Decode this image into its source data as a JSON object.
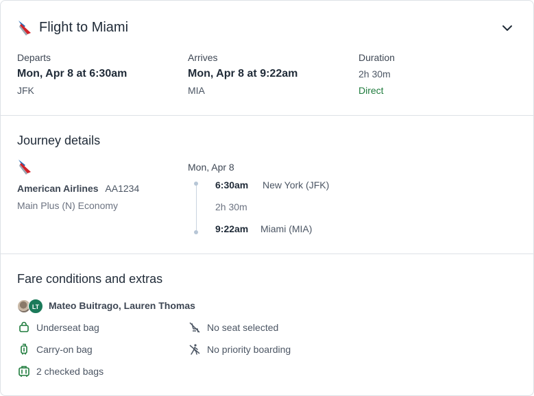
{
  "header": {
    "title": "Flight to Miami",
    "depart_label": "Departs",
    "depart_time": "Mon, Apr 8 at 6:30am",
    "depart_airport": "JFK",
    "arrive_label": "Arrives",
    "arrive_time": "Mon, Apr 8 at 9:22am",
    "arrive_airport": "MIA",
    "duration_label": "Duration",
    "duration": "2h 30m",
    "stops": "Direct"
  },
  "journey": {
    "heading": "Journey details",
    "airline": "American Airlines",
    "flight_number": "AA1234",
    "cabin": "Main Plus (N) Economy",
    "date": "Mon, Apr 8",
    "departure_time": "6:30am",
    "departure_place": "New York (JFK)",
    "leg_duration": "2h 30m",
    "arrival_time": "9:22am",
    "arrival_place": "Miami (MIA)"
  },
  "fare": {
    "heading": "Fare conditions and extras",
    "avatar_initials": "LT",
    "passengers": "Mateo Buitrago, Lauren Thomas",
    "items_left": [
      {
        "label": "Underseat bag",
        "icon": "underseat-bag-icon"
      },
      {
        "label": "Carry-on bag",
        "icon": "carry-on-bag-icon"
      },
      {
        "label": "2 checked bags",
        "icon": "checked-bags-icon"
      }
    ],
    "items_right": [
      {
        "label": "No seat selected",
        "icon": "no-seat-icon"
      },
      {
        "label": "No priority boarding",
        "icon": "no-priority-boarding-icon"
      }
    ]
  },
  "colors": {
    "accent_green": "#1e7b3c",
    "avatar_green": "#1b7a5a",
    "airline_red": "#d2232a",
    "airline_blue": "#2b6fb6"
  }
}
